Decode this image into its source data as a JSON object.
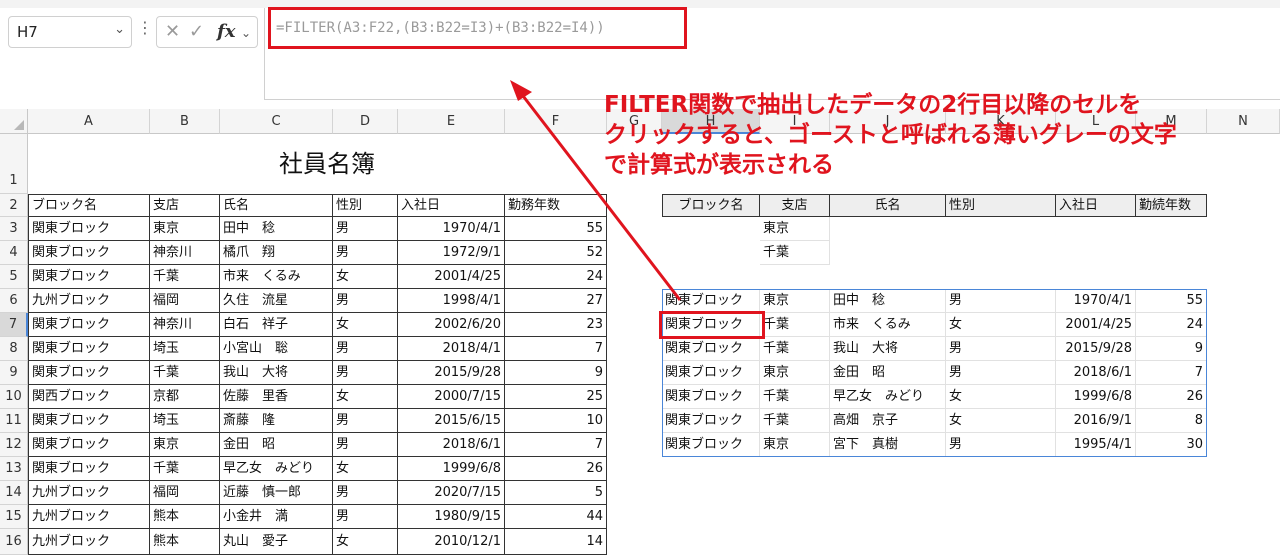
{
  "ribbon": {
    "name_box": "H7",
    "fx_label": "fx",
    "formula": "=FILTER(A3:F22,(B3:B22=I3)+(B3:B22=I4))"
  },
  "annotation": {
    "lines": [
      "FILTER関数で抽出したデータの2行目以降のセルを",
      "クリックすると、ゴーストと呼ばれる薄いグレーの文字",
      "で計算式が表示される"
    ],
    "color": "#e0141e"
  },
  "columns": [
    "A",
    "B",
    "C",
    "D",
    "E",
    "F",
    "G",
    "H",
    "I",
    "J",
    "K",
    "L",
    "M",
    "N"
  ],
  "rows": [
    "1",
    "2",
    "3",
    "4",
    "5",
    "6",
    "7",
    "8",
    "9",
    "10",
    "11",
    "12",
    "13",
    "14",
    "15",
    "16"
  ],
  "left_table": {
    "title": "社員名簿",
    "headers": [
      "ブロック名",
      "支店",
      "氏名",
      "性別",
      "入社日",
      "勤務年数"
    ],
    "rows": [
      [
        "関東ブロック",
        "東京",
        "田中　稔",
        "男",
        "1970/4/1",
        "55"
      ],
      [
        "関東ブロック",
        "神奈川",
        "橘爪　翔",
        "男",
        "1972/9/1",
        "52"
      ],
      [
        "関東ブロック",
        "千葉",
        "市来　くるみ",
        "女",
        "2001/4/25",
        "24"
      ],
      [
        "九州ブロック",
        "福岡",
        "久住　流星",
        "男",
        "1998/4/1",
        "27"
      ],
      [
        "関東ブロック",
        "神奈川",
        "白石　祥子",
        "女",
        "2002/6/20",
        "23"
      ],
      [
        "関東ブロック",
        "埼玉",
        "小宮山　聡",
        "男",
        "2018/4/1",
        "7"
      ],
      [
        "関東ブロック",
        "千葉",
        "我山　大将",
        "男",
        "2015/9/28",
        "9"
      ],
      [
        "関西ブロック",
        "京都",
        "佐藤　里香",
        "女",
        "2000/7/15",
        "25"
      ],
      [
        "関東ブロック",
        "埼玉",
        "斎藤　隆",
        "男",
        "2015/6/15",
        "10"
      ],
      [
        "関東ブロック",
        "東京",
        "金田　昭",
        "男",
        "2018/6/1",
        "7"
      ],
      [
        "関東ブロック",
        "千葉",
        "早乙女　みどり",
        "女",
        "1999/6/8",
        "26"
      ],
      [
        "九州ブロック",
        "福岡",
        "近藤　慎一郎",
        "男",
        "2020/7/15",
        "5"
      ],
      [
        "九州ブロック",
        "熊本",
        "小金井　満",
        "男",
        "1980/9/15",
        "44"
      ],
      [
        "九州ブロック",
        "熊本",
        "丸山　愛子",
        "女",
        "2010/12/1",
        "14"
      ]
    ]
  },
  "criteria": [
    "東京",
    "千葉"
  ],
  "right_table": {
    "headers": [
      "ブロック名",
      "支店",
      "氏名",
      "性別",
      "入社日",
      "勤続年数"
    ],
    "rows": [
      [
        "関東ブロック",
        "東京",
        "田中　稔",
        "男",
        "1970/4/1",
        "55"
      ],
      [
        "関東ブロック",
        "千葉",
        "市来　くるみ",
        "女",
        "2001/4/25",
        "24"
      ],
      [
        "関東ブロック",
        "千葉",
        "我山　大将",
        "男",
        "2015/9/28",
        "9"
      ],
      [
        "関東ブロック",
        "東京",
        "金田　昭",
        "男",
        "2018/6/1",
        "7"
      ],
      [
        "関東ブロック",
        "千葉",
        "早乙女　みどり",
        "女",
        "1999/6/8",
        "26"
      ],
      [
        "関東ブロック",
        "千葉",
        "高畑　京子",
        "女",
        "2016/9/1",
        "8"
      ],
      [
        "関東ブロック",
        "東京",
        "宮下　真樹",
        "男",
        "1995/4/1",
        "30"
      ]
    ]
  }
}
